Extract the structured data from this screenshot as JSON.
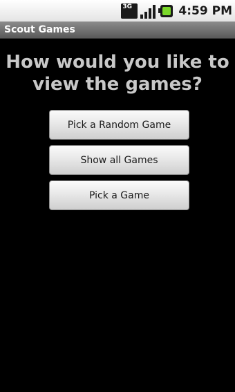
{
  "status_bar": {
    "network_label": "3G",
    "time": "4:59 PM",
    "signal_level": 1.0,
    "battery_color": "#7bd82a"
  },
  "app": {
    "title": "Scout Games"
  },
  "main": {
    "prompt": "How would you like to view the games?",
    "buttons": [
      {
        "label": "Pick a Random Game"
      },
      {
        "label": "Show all Games"
      },
      {
        "label": "Pick a Game"
      }
    ]
  }
}
